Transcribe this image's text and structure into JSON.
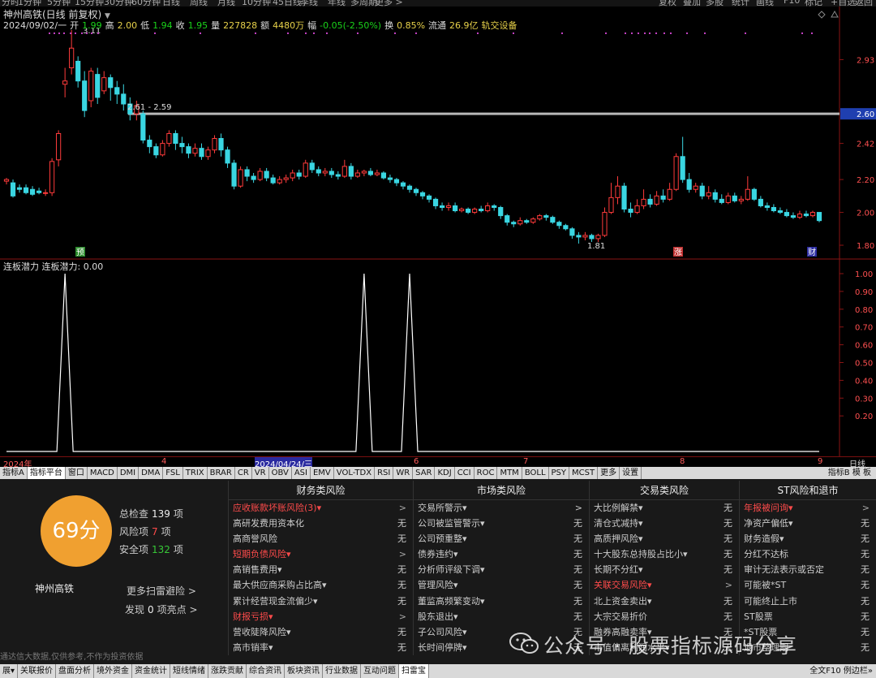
{
  "topbar": [
    "分时",
    "1分钟",
    "5分钟",
    "15分钟",
    "30分钟",
    "60分钟",
    "日线",
    "周线",
    "月线",
    "10分钟",
    "45日线",
    "季线",
    "年线",
    "多周期",
    "更多 >",
    "复权",
    "叠加",
    "多股",
    "统计",
    "画线",
    "F10",
    "标记",
    "+自选",
    "返回"
  ],
  "header": {
    "title": "神州高铁(日线 前复权)",
    "date": "2024/09/02/一",
    "open_label": "开",
    "open": "1.99",
    "high_label": "高",
    "high": "2.00",
    "low_label": "低",
    "low": "1.94",
    "close_label": "收",
    "close": "1.95",
    "vol_label": "量",
    "vol": "227828",
    "amt_label": "额",
    "amt": "4480万",
    "chg_label": "幅",
    "chg": "-0.05(-2.50%)",
    "turn_label": "换",
    "turn": "0.85%",
    "float_label": "流通",
    "float": "26.9亿",
    "track": "轨交设备"
  },
  "chart_data": {
    "type": "candlestick",
    "price_axis": {
      "labels": [
        "2.93",
        "2.60",
        "2.42",
        "2.20",
        "2.00",
        "1.80"
      ],
      "min": 1.76,
      "max": 3.13,
      "highlight": "2.60"
    },
    "annotations": [
      {
        "text": "3.11"
      },
      {
        "text": "2.61 - 2.59"
      },
      {
        "text": "1.81"
      }
    ],
    "markers": [
      "预",
      "涨",
      "财"
    ],
    "candles": [
      [
        2.19,
        2.2,
        2.17,
        2.21
      ],
      [
        2.18,
        2.1,
        2.09,
        2.2
      ],
      [
        2.15,
        2.14,
        2.12,
        2.17
      ],
      [
        2.15,
        2.12,
        2.11,
        2.17
      ],
      [
        2.14,
        2.11,
        2.1,
        2.16
      ],
      [
        2.13,
        2.12,
        2.11,
        2.15
      ],
      [
        2.12,
        2.12,
        2.1,
        2.14
      ],
      [
        2.12,
        2.31,
        2.1,
        2.33
      ],
      [
        2.32,
        2.48,
        2.28,
        2.5
      ],
      [
        2.78,
        2.8,
        2.7,
        2.88
      ],
      [
        2.88,
        3.0,
        2.84,
        3.11
      ],
      [
        2.92,
        2.8,
        2.76,
        2.95
      ],
      [
        2.8,
        2.62,
        2.58,
        2.86
      ],
      [
        2.68,
        2.86,
        2.64,
        2.88
      ],
      [
        2.84,
        2.7,
        2.66,
        2.88
      ],
      [
        2.74,
        2.82,
        2.72,
        2.86
      ],
      [
        2.82,
        2.76,
        2.68,
        2.84
      ],
      [
        2.76,
        2.72,
        2.66,
        2.8
      ],
      [
        2.72,
        2.66,
        2.62,
        2.78
      ],
      [
        2.66,
        2.6,
        2.56,
        2.7
      ],
      [
        2.6,
        2.65,
        2.56,
        2.68
      ],
      [
        2.6,
        2.44,
        2.42,
        2.62
      ],
      [
        2.44,
        2.4,
        2.36,
        2.47
      ],
      [
        2.4,
        2.35,
        2.33,
        2.42
      ],
      [
        2.35,
        2.42,
        2.34,
        2.44
      ],
      [
        2.42,
        2.48,
        2.4,
        2.5
      ],
      [
        2.48,
        2.42,
        2.38,
        2.5
      ],
      [
        2.42,
        2.4,
        2.36,
        2.46
      ],
      [
        2.4,
        2.36,
        2.33,
        2.42
      ],
      [
        2.36,
        2.39,
        2.34,
        2.42
      ],
      [
        2.39,
        2.34,
        2.32,
        2.42
      ],
      [
        2.34,
        2.38,
        2.32,
        2.4
      ],
      [
        2.38,
        2.45,
        2.36,
        2.47
      ],
      [
        2.45,
        2.38,
        2.34,
        2.48
      ],
      [
        2.38,
        2.3,
        2.27,
        2.4
      ],
      [
        2.3,
        2.16,
        2.14,
        2.32
      ],
      [
        2.16,
        2.26,
        2.15,
        2.28
      ],
      [
        2.26,
        2.22,
        2.19,
        2.28
      ],
      [
        2.22,
        2.2,
        2.18,
        2.24
      ],
      [
        2.2,
        2.25,
        2.19,
        2.27
      ],
      [
        2.25,
        2.21,
        2.19,
        2.27
      ],
      [
        2.21,
        2.18,
        2.17,
        2.23
      ],
      [
        2.18,
        2.2,
        2.17,
        2.22
      ],
      [
        2.2,
        2.21,
        2.18,
        2.23
      ],
      [
        2.21,
        2.24,
        2.19,
        2.26
      ],
      [
        2.24,
        2.22,
        2.2,
        2.26
      ],
      [
        2.22,
        2.3,
        2.21,
        2.32
      ],
      [
        2.3,
        2.26,
        2.24,
        2.32
      ],
      [
        2.26,
        2.24,
        2.22,
        2.28
      ],
      [
        2.24,
        2.25,
        2.22,
        2.27
      ],
      [
        2.25,
        2.23,
        2.21,
        2.27
      ],
      [
        2.23,
        2.22,
        2.2,
        2.25
      ],
      [
        2.22,
        2.28,
        2.21,
        2.32
      ],
      [
        2.28,
        2.22,
        2.2,
        2.3
      ],
      [
        2.22,
        2.24,
        2.21,
        2.26
      ],
      [
        2.24,
        2.25,
        2.22,
        2.26
      ],
      [
        2.25,
        2.23,
        2.22,
        2.27
      ],
      [
        2.23,
        2.24,
        2.22,
        2.26
      ],
      [
        2.24,
        2.21,
        2.2,
        2.25
      ],
      [
        2.21,
        2.2,
        2.18,
        2.23
      ],
      [
        2.2,
        2.18,
        2.16,
        2.21
      ],
      [
        2.18,
        2.16,
        2.14,
        2.19
      ],
      [
        2.16,
        2.14,
        2.12,
        2.17
      ],
      [
        2.14,
        2.12,
        2.1,
        2.15
      ],
      [
        2.12,
        2.1,
        2.08,
        2.13
      ],
      [
        2.1,
        2.08,
        2.06,
        2.11
      ],
      [
        2.08,
        2.04,
        2.02,
        2.09
      ],
      [
        2.04,
        2.03,
        2.01,
        2.06
      ],
      [
        2.03,
        2.04,
        2.01,
        2.06
      ],
      [
        2.04,
        2.01,
        2.0,
        2.06
      ],
      [
        2.01,
        2.02,
        2.0,
        2.03
      ],
      [
        2.02,
        2.0,
        1.99,
        2.03
      ],
      [
        2.0,
        2.02,
        1.99,
        2.03
      ],
      [
        2.02,
        2.01,
        2.0,
        2.04
      ],
      [
        2.01,
        2.04,
        2.0,
        2.06
      ],
      [
        2.04,
        2.03,
        2.01,
        2.05
      ],
      [
        2.03,
        1.98,
        1.96,
        2.04
      ],
      [
        1.98,
        1.94,
        1.92,
        1.99
      ],
      [
        1.94,
        1.93,
        1.91,
        1.95
      ],
      [
        1.93,
        1.95,
        1.92,
        1.97
      ],
      [
        1.95,
        1.94,
        1.93,
        1.96
      ],
      [
        1.94,
        1.96,
        1.93,
        1.97
      ],
      [
        1.96,
        1.98,
        1.95,
        1.99
      ],
      [
        1.98,
        1.97,
        1.95,
        1.99
      ],
      [
        1.97,
        1.94,
        1.93,
        1.98
      ],
      [
        1.94,
        1.92,
        1.9,
        1.95
      ],
      [
        1.92,
        1.9,
        1.89,
        1.93
      ],
      [
        1.9,
        1.86,
        1.84,
        1.91
      ],
      [
        1.86,
        1.85,
        1.81,
        1.88
      ],
      [
        1.85,
        1.86,
        1.83,
        1.88
      ],
      [
        1.86,
        1.84,
        1.82,
        1.87
      ],
      [
        1.84,
        1.86,
        1.82,
        1.87
      ],
      [
        1.86,
        2.0,
        1.85,
        2.03
      ],
      [
        2.0,
        2.09,
        1.99,
        2.18
      ],
      [
        2.09,
        2.16,
        2.05,
        2.22
      ],
      [
        2.16,
        2.02,
        2.0,
        2.18
      ],
      [
        2.02,
        2.0,
        1.97,
        2.06
      ],
      [
        2.0,
        2.04,
        1.99,
        2.08
      ],
      [
        2.04,
        2.08,
        2.02,
        2.14
      ],
      [
        2.08,
        2.05,
        2.03,
        2.11
      ],
      [
        2.05,
        2.1,
        2.04,
        2.13
      ],
      [
        2.1,
        2.08,
        2.06,
        2.14
      ],
      [
        2.08,
        2.14,
        2.07,
        2.18
      ],
      [
        2.14,
        2.34,
        2.13,
        2.36
      ],
      [
        2.34,
        2.2,
        2.18,
        2.46
      ],
      [
        2.2,
        2.14,
        2.12,
        2.24
      ],
      [
        2.14,
        2.16,
        2.12,
        2.18
      ],
      [
        2.16,
        2.1,
        2.08,
        2.18
      ],
      [
        2.1,
        2.12,
        2.08,
        2.16
      ],
      [
        2.12,
        2.08,
        2.06,
        2.14
      ],
      [
        2.08,
        2.06,
        2.05,
        2.11
      ],
      [
        2.06,
        2.1,
        2.05,
        2.12
      ],
      [
        2.1,
        2.07,
        2.06,
        2.12
      ],
      [
        2.07,
        2.08,
        2.05,
        2.1
      ],
      [
        2.08,
        2.14,
        2.07,
        2.22
      ],
      [
        2.14,
        2.08,
        2.07,
        2.15
      ],
      [
        2.08,
        2.04,
        2.03,
        2.1
      ],
      [
        2.04,
        2.03,
        2.01,
        2.06
      ],
      [
        2.03,
        2.01,
        2.0,
        2.05
      ],
      [
        2.01,
        2.0,
        1.99,
        2.03
      ],
      [
        2.0,
        1.98,
        1.97,
        2.02
      ],
      [
        1.98,
        1.97,
        1.96,
        2.0
      ],
      [
        1.97,
        1.99,
        1.96,
        2.01
      ],
      [
        1.99,
        1.98,
        1.97,
        2.01
      ],
      [
        1.98,
        2.0,
        1.97,
        2.01
      ],
      [
        2.0,
        1.95,
        1.94,
        2.0
      ]
    ],
    "indicator": {
      "name": "连板潜力",
      "value_label": "连板潜力: 0.00",
      "axis": [
        "1.00",
        "0.90",
        "0.80",
        "0.70",
        "0.60",
        "0.50",
        "0.40",
        "0.30",
        "0.20"
      ],
      "spike_indices": [
        9,
        55,
        62,
        126
      ]
    },
    "x_labels": [
      "2024年",
      "4",
      "2024/04/24/三",
      "6",
      "7",
      "8",
      "9"
    ]
  },
  "indicator_tabs": [
    "指标A",
    "指标平台",
    "窗口",
    "MACD",
    "DMI",
    "DMA",
    "FSL",
    "TRIX",
    "BRAR",
    "CR",
    "VR",
    "OBV",
    "ASI",
    "EMV",
    "VOL-TDX",
    "RSI",
    "WR",
    "SAR",
    "KDJ",
    "CCI",
    "ROC",
    "MTM",
    "BOLL",
    "PSY",
    "MCST",
    "更多",
    "设置"
  ],
  "ind_right": "指标B 模 板",
  "x_right": "日线",
  "panel": {
    "score": "69分",
    "stock_name": "神州高铁",
    "total_label": "总检查",
    "total": "139",
    "total_unit": "项",
    "risk_label": "风险项",
    "risk": "7",
    "risk_unit": "项",
    "safe_label": "安全项",
    "safe": "132",
    "safe_unit": "项",
    "more_link": "更多扫雷避险 >",
    "find_label": "发现",
    "find": "0",
    "find_unit": "项亮点 >",
    "columns": [
      {
        "title": "财务类风险",
        "rows": [
          [
            "应收账款坏账风险(3)▾",
            ">",
            true
          ],
          [
            "高研发费用资本化",
            "无",
            false
          ],
          [
            "高商誉风险",
            "无",
            false
          ],
          [
            "短期负债风险▾",
            ">",
            true
          ],
          [
            "高销售费用▾",
            "无",
            false
          ],
          [
            "最大供应商采购占比高▾",
            "无",
            false
          ],
          [
            "累计经营现金流偏少▾",
            "无",
            false
          ],
          [
            "财报亏损▾",
            ">",
            true
          ],
          [
            "营收陡降风险▾",
            "无",
            false
          ],
          [
            "高市销率▾",
            "无",
            false
          ]
        ]
      },
      {
        "title": "市场类风险",
        "rows": [
          [
            "交易所警示▾",
            ">",
            false
          ],
          [
            "公司被监管警示▾",
            "无",
            false
          ],
          [
            "公司预重整▾",
            "无",
            false
          ],
          [
            "债券违约▾",
            "无",
            false
          ],
          [
            "分析师评级下调▾",
            "无",
            false
          ],
          [
            "管理风险▾",
            "无",
            false
          ],
          [
            "董监高频繁变动▾",
            "无",
            false
          ],
          [
            "股东退出▾",
            "无",
            false
          ],
          [
            "子公司风险▾",
            "无",
            false
          ],
          [
            "长时间停牌▾",
            "无",
            false
          ]
        ]
      },
      {
        "title": "交易类风险",
        "rows": [
          [
            "大比例解禁▾",
            "无",
            false
          ],
          [
            "清仓式减持▾",
            "无",
            false
          ],
          [
            "高质押风险▾",
            "无",
            false
          ],
          [
            "十大股东总持股占比小▾",
            "无",
            false
          ],
          [
            "长期不分红▾",
            "无",
            false
          ],
          [
            "关联交易风险▾",
            ">",
            true
          ],
          [
            "北上资金卖出▾",
            "无",
            false
          ],
          [
            "大宗交易折价",
            "无",
            false
          ],
          [
            "融券高融卖率▾",
            "无",
            false
          ],
          [
            "市值偏离利润水平▾",
            "无",
            false
          ]
        ]
      },
      {
        "title": "ST风险和退市",
        "rows": [
          [
            "年报被问询▾",
            ">",
            true
          ],
          [
            "净资产偏低▾",
            "无",
            false
          ],
          [
            "财务造假▾",
            "无",
            false
          ],
          [
            "分红不达标",
            "无",
            false
          ],
          [
            "审计无法表示或否定",
            "无",
            false
          ],
          [
            "可能被*ST",
            "无",
            false
          ],
          [
            "可能终止上市",
            "无",
            false
          ],
          [
            "ST股票",
            "无",
            false
          ],
          [
            "*ST股票",
            "无",
            false
          ],
          [
            "退市整理期",
            "无",
            false
          ]
        ]
      }
    ],
    "disclaimer": "通达信大数据,仅供参考,不作为投资依据"
  },
  "watermark": "公众号 · 股票指标源码分享",
  "bottom_tabs": [
    "展▾",
    "关联报价",
    "盘面分析",
    "境外资金",
    "资金统计",
    "短线情绪",
    "涨跌贡献",
    "综合资讯",
    "板块资讯",
    "行业数据",
    "互动问题",
    "扫雷宝"
  ],
  "bottom_right": "全文F10 例边栏»",
  "colors": {
    "up": "#ff3b3b",
    "down": "#3ad6e2",
    "accent": "#f0a030"
  }
}
